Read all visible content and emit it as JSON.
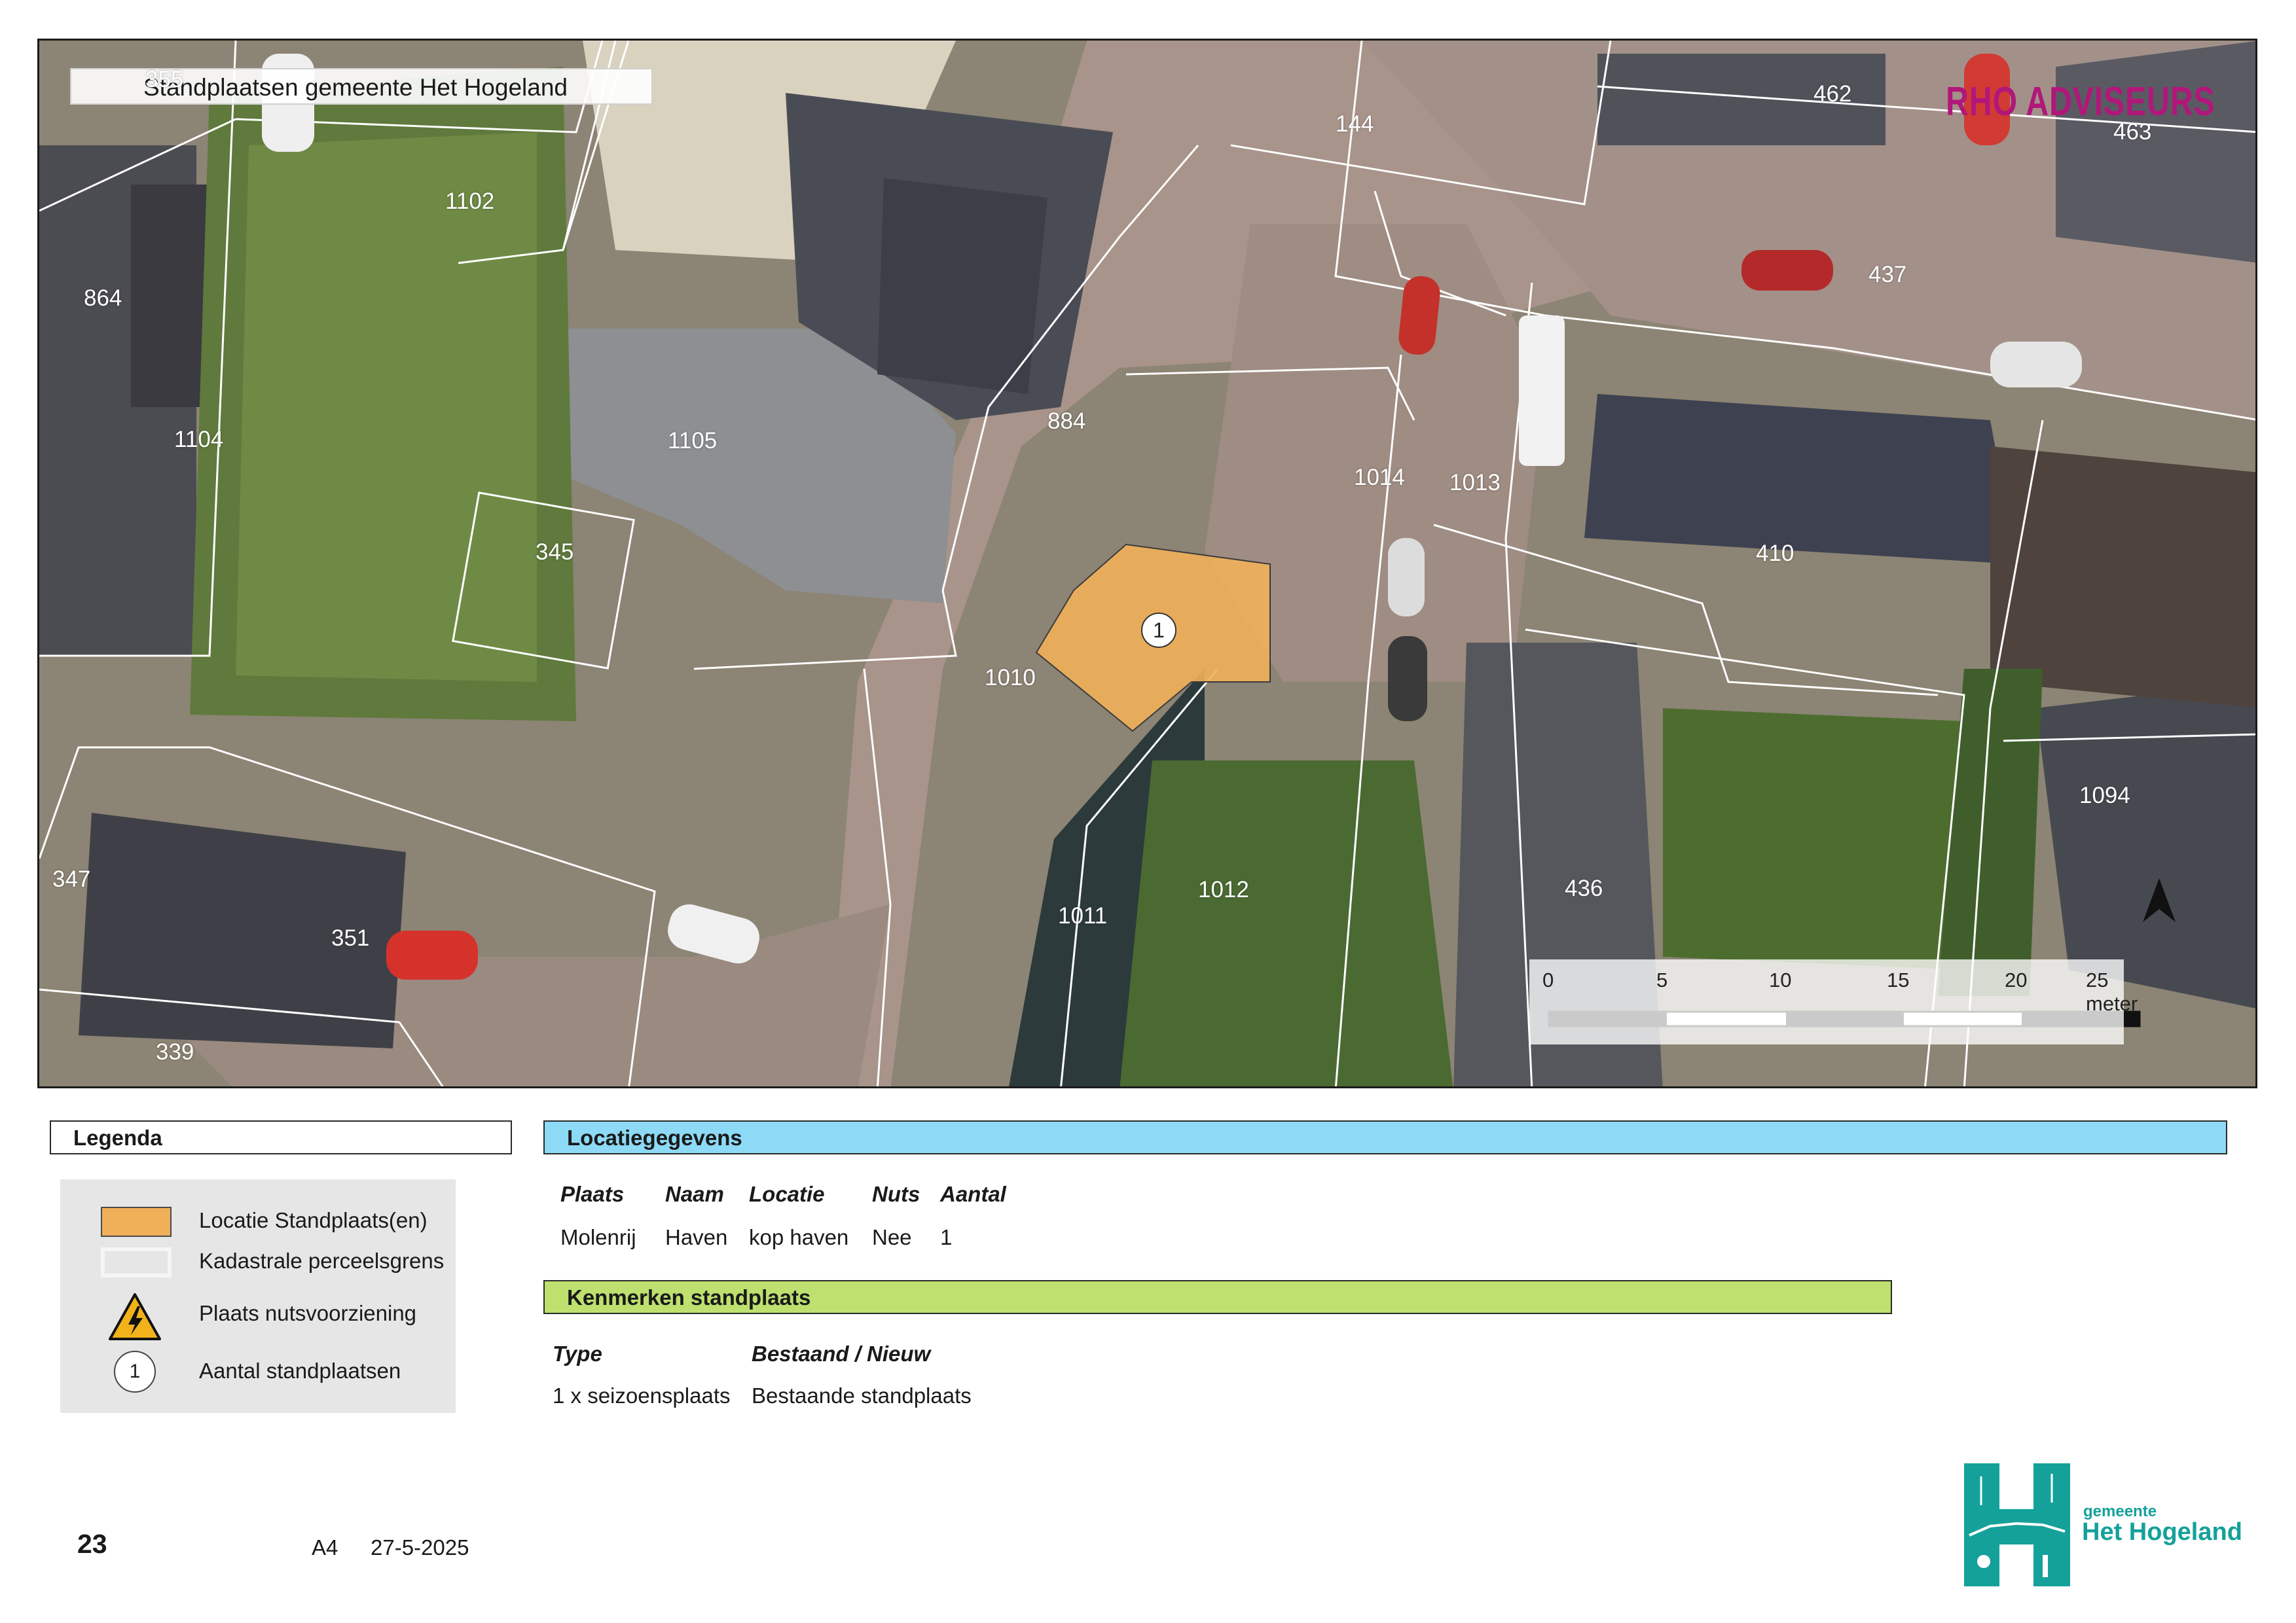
{
  "map": {
    "title": "Standplaatsen gemeente Het Hogeland",
    "brand": "RHO ADVISEURS",
    "marker_label": "1",
    "parcels": [
      {
        "id": "p355",
        "label": "355"
      },
      {
        "id": "p1102",
        "label": "1102"
      },
      {
        "id": "p144",
        "label": "144"
      },
      {
        "id": "p462",
        "label": "462"
      },
      {
        "id": "p463",
        "label": "463"
      },
      {
        "id": "p864",
        "label": "864"
      },
      {
        "id": "p437",
        "label": "437"
      },
      {
        "id": "p1104",
        "label": "1104"
      },
      {
        "id": "p1105",
        "label": "1105"
      },
      {
        "id": "p884",
        "label": "884"
      },
      {
        "id": "p1014",
        "label": "1014"
      },
      {
        "id": "p1013",
        "label": "1013"
      },
      {
        "id": "p345",
        "label": "345"
      },
      {
        "id": "p410",
        "label": "410"
      },
      {
        "id": "p1010",
        "label": "1010"
      },
      {
        "id": "p1094",
        "label": "1094"
      },
      {
        "id": "p347",
        "label": "347"
      },
      {
        "id": "p351",
        "label": "351"
      },
      {
        "id": "p1012",
        "label": "1012"
      },
      {
        "id": "p1011",
        "label": "1011"
      },
      {
        "id": "p436",
        "label": "436"
      },
      {
        "id": "p339",
        "label": "339"
      }
    ],
    "scale": {
      "ticks": [
        "0",
        "5",
        "10",
        "15",
        "20"
      ],
      "end_label": "25 meter"
    }
  },
  "legend": {
    "heading": "Legenda",
    "items": [
      {
        "label": "Locatie Standplaats(en)"
      },
      {
        "label": "Kadastrale perceelsgrens"
      },
      {
        "label": "Plaats nutsvoorziening"
      },
      {
        "label": "Aantal standplaatsen",
        "symbol": "1"
      }
    ]
  },
  "locatie": {
    "heading": "Locatiegegevens",
    "columns": [
      "Plaats",
      "Naam",
      "Locatie",
      "Nuts",
      "Aantal"
    ],
    "row": [
      "Molenrij",
      "Haven",
      "kop haven",
      "Nee",
      "1"
    ]
  },
  "kenmerken": {
    "heading": "Kenmerken standplaats",
    "columns": [
      "Type",
      "Bestaand / Nieuw"
    ],
    "row": [
      "1 x seizoensplaats",
      "Bestaande standplaats"
    ]
  },
  "footer": {
    "page": "23",
    "format": "A4",
    "date": "27-5-2025"
  },
  "logo": {
    "line1": "gemeente",
    "line2": "Het Hogeland"
  },
  "colors": {
    "standplaats": "#f0b05a",
    "locatie_head": "#8cdaf6",
    "kenmerken_head": "#bde06e",
    "brand": "#b1177a",
    "logo": "#14a19a"
  }
}
